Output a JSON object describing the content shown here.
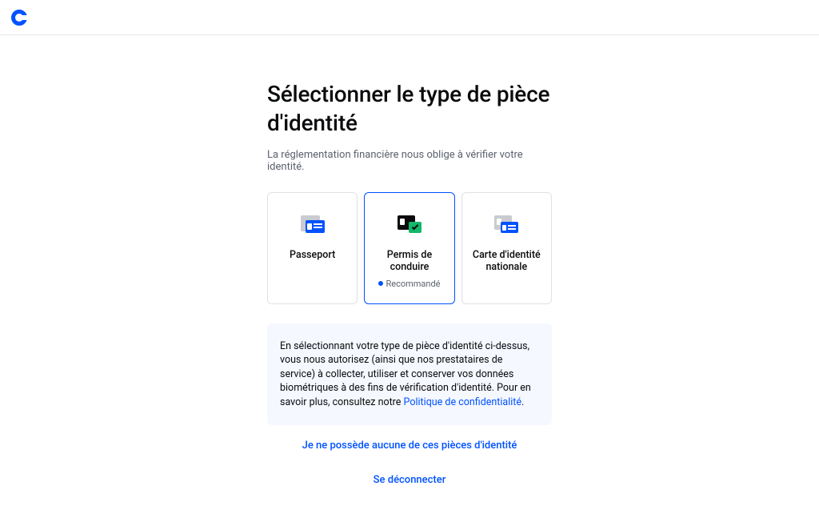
{
  "heading": "Sélectionner le type de pièce d'identité",
  "subtitle": "La réglementation financière nous oblige à vérifier votre identité.",
  "options": {
    "passport": {
      "label": "Passeport"
    },
    "license": {
      "label": "Permis de conduire",
      "badge": "Recommandé"
    },
    "national_id": {
      "label": "Carte d'identité nationale"
    }
  },
  "notice_prefix": "En sélectionnant votre type de pièce d'identité ci-dessus, vous nous autorisez (ainsi que nos prestataires de service) à collecter, utiliser et conserver vos données biométriques à des fins de vérification d'identité. Pour en savoir plus, consultez notre ",
  "notice_link": "Politique de confidentialité",
  "notice_suffix": ".",
  "no_id_link": "Je ne possède aucune de ces pièces d'identité",
  "sign_out": "Se déconnecter"
}
